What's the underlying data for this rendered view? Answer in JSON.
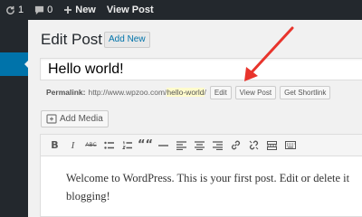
{
  "adminbar": {
    "updates_count": "1",
    "comments_count": "0",
    "new_label": "New",
    "view_post_label": "View Post"
  },
  "page": {
    "title": "Edit Post",
    "add_new_label": "Add New"
  },
  "post": {
    "title_value": "Hello world!",
    "permalink_label": "Permalink:",
    "permalink_base": "http://www.wpzoo.com/",
    "permalink_slug": "hello-world",
    "permalink_trail": "/",
    "edit_label": "Edit",
    "view_post_label": "View Post",
    "get_shortlink_label": "Get Shortlink"
  },
  "media": {
    "add_media_label": "Add Media"
  },
  "editor": {
    "toolbar": {
      "bold": "B",
      "italic": "I",
      "strikethrough": "ABC",
      "quote": "““"
    },
    "line1": "Welcome to WordPress. This is your first post. Edit or delete it",
    "line2": "blogging!"
  },
  "colors": {
    "adminbar": "#23282d",
    "active_menu": "#0073aa",
    "annotation_arrow": "#e8342c",
    "slug_highlight": "#fffbcc"
  }
}
